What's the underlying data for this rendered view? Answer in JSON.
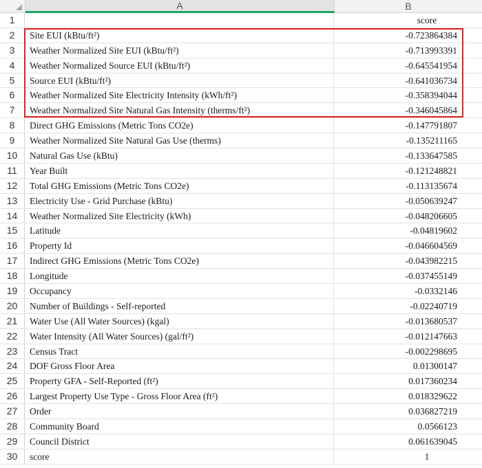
{
  "columns": [
    "A",
    "B"
  ],
  "rows": [
    {
      "num": "1",
      "a": "",
      "b": "score",
      "b_center": true
    },
    {
      "num": "2",
      "a": "Site EUI (kBtu/ft²)",
      "b": "-0.723864384"
    },
    {
      "num": "3",
      "a": "Weather Normalized Site EUI (kBtu/ft²)",
      "b": "-0.713993391"
    },
    {
      "num": "4",
      "a": "Weather Normalized Source EUI (kBtu/ft²)",
      "b": "-0.645541954"
    },
    {
      "num": "5",
      "a": "Source EUI (kBtu/ft²)",
      "b": "-0.641036734"
    },
    {
      "num": "6",
      "a": "Weather Normalized Site Electricity Intensity (kWh/ft²)",
      "b": "-0.358394044"
    },
    {
      "num": "7",
      "a": "Weather Normalized Site Natural Gas Intensity (therms/ft²)",
      "b": "-0.346045864"
    },
    {
      "num": "8",
      "a": "Direct GHG Emissions (Metric Tons CO2e)",
      "b": "-0.147791807"
    },
    {
      "num": "9",
      "a": "Weather Normalized Site Natural Gas Use (therms)",
      "b": "-0.135211165"
    },
    {
      "num": "10",
      "a": "Natural Gas Use (kBtu)",
      "b": "-0.133647585"
    },
    {
      "num": "11",
      "a": "Year Built",
      "b": "-0.121248821"
    },
    {
      "num": "12",
      "a": "Total GHG Emissions (Metric Tons CO2e)",
      "b": "-0.113135674"
    },
    {
      "num": "13",
      "a": "Electricity Use - Grid Purchase (kBtu)",
      "b": "-0.050639247"
    },
    {
      "num": "14",
      "a": "Weather Normalized Site Electricity (kWh)",
      "b": "-0.048206605"
    },
    {
      "num": "15",
      "a": "Latitude",
      "b": "-0.04819602"
    },
    {
      "num": "16",
      "a": "Property Id",
      "b": "-0.046604569"
    },
    {
      "num": "17",
      "a": "Indirect GHG Emissions (Metric Tons CO2e)",
      "b": "-0.043982215"
    },
    {
      "num": "18",
      "a": "Longitude",
      "b": "-0.037455149"
    },
    {
      "num": "19",
      "a": "Occupancy",
      "b": "-0.0332146"
    },
    {
      "num": "20",
      "a": "Number of Buildings - Self-reported",
      "b": "-0.02240719"
    },
    {
      "num": "21",
      "a": "Water Use (All Water Sources) (kgal)",
      "b": "-0.013680537"
    },
    {
      "num": "22",
      "a": "Water Intensity (All Water Sources) (gal/ft²)",
      "b": "-0.012147663"
    },
    {
      "num": "23",
      "a": "Census Tract",
      "b": "-0.002298695"
    },
    {
      "num": "24",
      "a": "DOF Gross Floor Area",
      "b": "0.01300147"
    },
    {
      "num": "25",
      "a": "Property GFA - Self-Reported (ft²)",
      "b": "0.017360234"
    },
    {
      "num": "26",
      "a": "Largest Property Use Type - Gross Floor Area (ft²)",
      "b": "0.018329622"
    },
    {
      "num": "27",
      "a": "Order",
      "b": "0.036827219"
    },
    {
      "num": "28",
      "a": "Community Board",
      "b": "0.0566123"
    },
    {
      "num": "29",
      "a": "Council District",
      "b": "0.061639045"
    },
    {
      "num": "30",
      "a": "score",
      "b": "1"
    }
  ],
  "colors": {
    "highlight": "#e02020",
    "selected_col_bar": "#1fa365"
  }
}
